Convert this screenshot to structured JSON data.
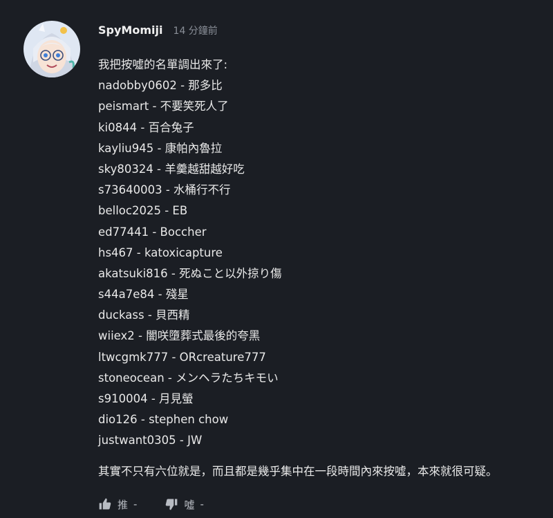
{
  "comment": {
    "username": "SpyMomiji",
    "time": "14 分鐘前",
    "lines": [
      "我把按噓的名單調出來了:",
      "nadobby0602 - 那多比",
      "peismart - 不要笑死人了",
      "ki0844 - 百合兔子",
      "kayliu945 - 康帕內魯拉",
      "sky80324 - 羊羹越甜越好吃",
      "s73640003 - 水桶行不行",
      "belloc2025 - EB",
      "ed77441 - Boccher",
      "hs467 - katoxicapture",
      "akatsuki816 - 死ぬこと以外掠り傷",
      "s44a7e84 - 殘星",
      "duckass - 貝西精",
      "wiiex2 - 闇咲墮葬式最後的夸黑",
      "ltwcgmk777 - ORcreature777",
      "stoneocean - メンヘラたちキモい",
      "s910004 - 月見螢",
      "dio126 - stephen chow",
      "justwant0305 - JW"
    ],
    "note": "其實不只有六位就是，而且都是幾乎集中在一段時間內來按噓，本來就很可疑。"
  },
  "actions": {
    "like_label": "推",
    "like_count": "-",
    "dislike_label": "噓",
    "dislike_count": "-",
    "like_icon": "thumbs-up-icon",
    "dislike_icon": "thumbs-down-icon"
  },
  "colors": {
    "background": "#1b1e24",
    "text": "#e9e9e9",
    "muted": "#8a8f98",
    "icon": "#b8bcc3"
  }
}
